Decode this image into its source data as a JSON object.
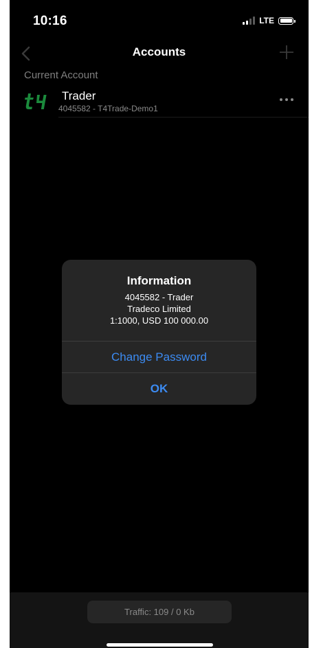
{
  "status_bar": {
    "time": "10:16",
    "network": "LTE"
  },
  "nav": {
    "title": "Accounts"
  },
  "accounts_section": {
    "header": "Current Account",
    "account": {
      "name": "Trader",
      "detail": "4045582 - T4Trade-Demo1",
      "logo_icon": "t4-logo-icon",
      "logo_color": "#1b8a3c"
    }
  },
  "dialog": {
    "title": "Information",
    "line1": "4045582 -  Trader",
    "line2": "Tradeco Limited",
    "line3": "1:1000, USD 100 000.00",
    "change_password_label": "Change Password",
    "ok_label": "OK",
    "button_color": "#3c8bf2"
  },
  "footer": {
    "traffic": "Traffic: 109 / 0 Kb"
  }
}
